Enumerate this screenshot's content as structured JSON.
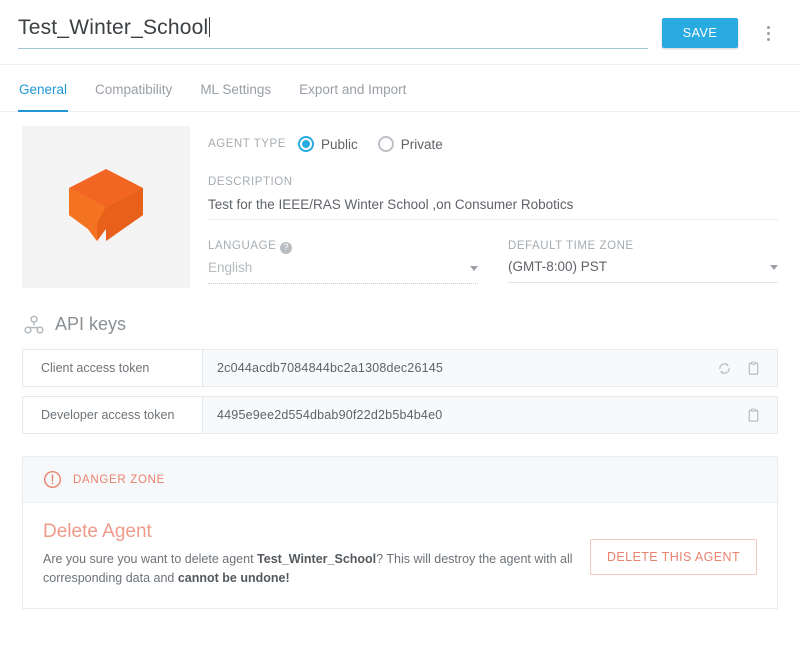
{
  "header": {
    "agent_name": "Test_Winter_School",
    "save_label": "SAVE",
    "more_menu_name": "more-options"
  },
  "tabs": [
    {
      "label": "General",
      "active": true
    },
    {
      "label": "Compatibility",
      "active": false
    },
    {
      "label": "ML Settings",
      "active": false
    },
    {
      "label": "Export and Import",
      "active": false
    }
  ],
  "general": {
    "avatar_icon": "agent-cube-logo",
    "agent_type_label": "AGENT TYPE",
    "agent_type_options": [
      {
        "label": "Public",
        "selected": true
      },
      {
        "label": "Private",
        "selected": false
      }
    ],
    "description_label": "DESCRIPTION",
    "description_value": "Test for the IEEE/RAS Winter School ,on Consumer Robotics",
    "language_label": "LANGUAGE",
    "language_help_glyph": "?",
    "language_value": "English",
    "timezone_label": "DEFAULT TIME ZONE",
    "timezone_value": "(GMT-8:00) PST"
  },
  "api_keys": {
    "section_title": "API keys",
    "section_icon": "share-nodes-icon",
    "rows": [
      {
        "label": "Client access token",
        "value": "2c044acdb7084844bc2a1308dec26145",
        "has_refresh": true,
        "has_copy": true
      },
      {
        "label": "Developer access token",
        "value": "4495e9ee2d554dbab90f22d2b5b4b4e0",
        "has_refresh": false,
        "has_copy": true
      }
    ]
  },
  "danger_zone": {
    "banner_label": "DANGER ZONE",
    "banner_icon": "alert-circle-icon",
    "title": "Delete Agent",
    "text_part_1": "Are you sure you want to delete agent ",
    "agent_name_bold": "Test_Winter_School",
    "text_part_2": "? This will destroy the agent with all corresponding data and ",
    "bold_warning": "cannot be undone!",
    "delete_button_label": "DELETE THIS AGENT"
  },
  "colors": {
    "accent_blue": "#29abe2",
    "danger_salmon": "#e8836f",
    "logo_orange": "#f26522"
  }
}
